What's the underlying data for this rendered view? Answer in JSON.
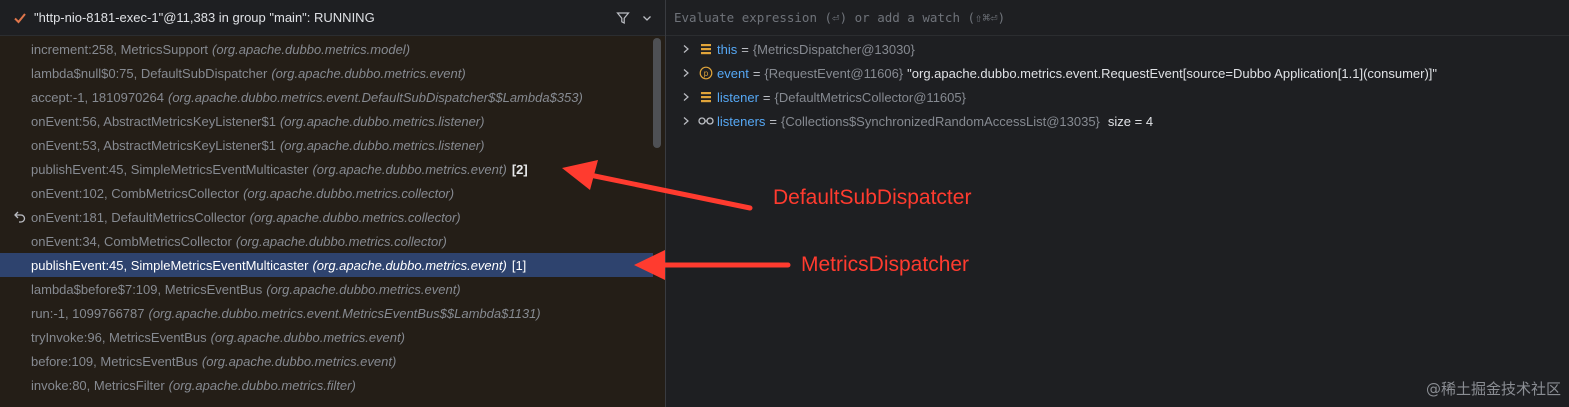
{
  "thread": {
    "title": "\"http-nio-8181-exec-1\"@11,383 in group \"main\": RUNNING",
    "check_icon": "check-icon",
    "filter_icon": "filter-icon",
    "dropdown_icon": "chevron-down-icon"
  },
  "frames": [
    {
      "loc": "increment:258, MetricsSupport",
      "pkg": "(org.apache.dubbo.metrics.model)",
      "badge": ""
    },
    {
      "loc": "lambda$null$0:75, DefaultSubDispatcher",
      "pkg": "(org.apache.dubbo.metrics.event)",
      "badge": ""
    },
    {
      "loc": "accept:-1, 1810970264",
      "pkg": "(org.apache.dubbo.metrics.event.DefaultSubDispatcher$$Lambda$353)",
      "badge": ""
    },
    {
      "loc": "onEvent:56, AbstractMetricsKeyListener$1",
      "pkg": "(org.apache.dubbo.metrics.listener)",
      "badge": ""
    },
    {
      "loc": "onEvent:53, AbstractMetricsKeyListener$1",
      "pkg": "(org.apache.dubbo.metrics.listener)",
      "badge": ""
    },
    {
      "loc": "publishEvent:45, SimpleMetricsEventMulticaster",
      "pkg": "(org.apache.dubbo.metrics.event)",
      "badge": "[2]"
    },
    {
      "loc": "onEvent:102, CombMetricsCollector",
      "pkg": "(org.apache.dubbo.metrics.collector)",
      "badge": ""
    },
    {
      "loc": "onEvent:181, DefaultMetricsCollector",
      "pkg": "(org.apache.dubbo.metrics.collector)",
      "badge": ""
    },
    {
      "loc": "onEvent:34, CombMetricsCollector",
      "pkg": "(org.apache.dubbo.metrics.collector)",
      "badge": ""
    },
    {
      "loc": "publishEvent:45, SimpleMetricsEventMulticaster",
      "pkg": "(org.apache.dubbo.metrics.event)",
      "badge": "[1]"
    },
    {
      "loc": "lambda$before$7:109, MetricsEventBus",
      "pkg": "(org.apache.dubbo.metrics.event)",
      "badge": ""
    },
    {
      "loc": "run:-1, 1099766787",
      "pkg": "(org.apache.dubbo.metrics.event.MetricsEventBus$$Lambda$1131)",
      "badge": ""
    },
    {
      "loc": "tryInvoke:96, MetricsEventBus",
      "pkg": "(org.apache.dubbo.metrics.event)",
      "badge": ""
    },
    {
      "loc": "before:109, MetricsEventBus",
      "pkg": "(org.apache.dubbo.metrics.event)",
      "badge": ""
    },
    {
      "loc": "invoke:80, MetricsFilter",
      "pkg": "(org.apache.dubbo.metrics.filter)",
      "badge": ""
    }
  ],
  "selected_frame_index": 9,
  "expression": {
    "placeholder": "Evaluate expression (⏎) or add a watch (⇧⌘⏎)"
  },
  "variables": [
    {
      "icon": "field-icon",
      "name": "this",
      "type": "{MetricsDispatcher@13030}",
      "value": "",
      "size": ""
    },
    {
      "icon": "parameter-icon",
      "name": "event",
      "type": "{RequestEvent@11606}",
      "value": "\"org.apache.dubbo.metrics.event.RequestEvent[source=Dubbo Application[1.1](consumer)]\"",
      "size": ""
    },
    {
      "icon": "field-icon",
      "name": "listener",
      "type": "{DefaultMetricsCollector@11605}",
      "value": "",
      "size": ""
    },
    {
      "icon": "watch-glasses-icon",
      "name": "listeners",
      "type": "{Collections$SynchronizedRandomAccessList@13035}",
      "value": "",
      "size": "size = 4"
    }
  ],
  "annotations": {
    "first": "DefaultSubDispatcter",
    "second": "MetricsDispatcher",
    "color": "#ff3b2f"
  },
  "watermark": "@稀土掘金技术社区",
  "colors": {
    "selection": "#2e436e",
    "frames_background": "#241e17",
    "variable_name": "#56a8f5"
  }
}
